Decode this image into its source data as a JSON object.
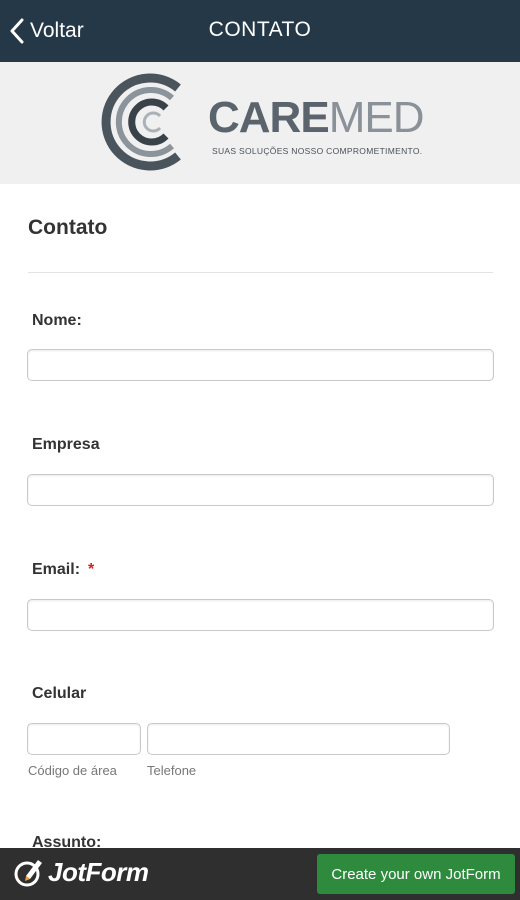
{
  "nav": {
    "back_label": "Voltar",
    "title": "CONTATO"
  },
  "logo": {
    "word_care": "CARE",
    "word_med": "MED",
    "tagline": "SUAS SOLUÇÕES NOSSO COMPROMETIMENTO."
  },
  "form": {
    "title": "Contato",
    "fields": {
      "nome": {
        "label": "Nome:",
        "value": ""
      },
      "empresa": {
        "label": "Empresa",
        "value": ""
      },
      "email": {
        "label": "Email:",
        "required_mark": "*",
        "value": ""
      },
      "celular": {
        "label": "Celular",
        "area_sublabel": "Código de área",
        "phone_sublabel": "Telefone",
        "area_value": "",
        "phone_value": ""
      },
      "assunto": {
        "label": "Assunto:"
      }
    }
  },
  "footer": {
    "brand": "JotForm",
    "button_label": "Create your own JotForm"
  },
  "colors": {
    "nav_bg": "#243848",
    "footer_bg": "#2f2f2f",
    "button_green": "#2e8b3d",
    "required_red": "#d21f1f"
  },
  "icons": {
    "back": "chevron-left-icon",
    "jotform": "jotform-pencil-icon"
  }
}
